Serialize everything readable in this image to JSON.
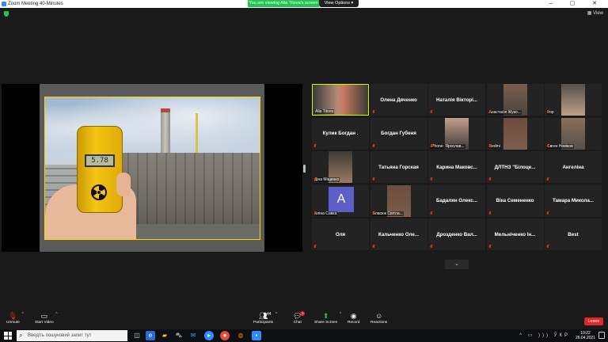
{
  "window": {
    "title": "Zoom Meeting 40-Minutes",
    "controls": "– ▢ ✕"
  },
  "banner": {
    "viewing_text": "You are viewing Alla Titova's screen",
    "view_options_label": "View Options ▾"
  },
  "topbar": {
    "view_label": "View"
  },
  "slide": {
    "dosimeter_reading": "5.78"
  },
  "gallery": {
    "tiles": [
      {
        "name": "Alla Titova",
        "style": "video"
      },
      {
        "name": "Олена Дяченко",
        "style": "name"
      },
      {
        "name": "Наталія Вікторі...",
        "style": "name"
      },
      {
        "name": "Анастасія Жуко...",
        "style": "video"
      },
      {
        "name": "Ігор",
        "style": "video"
      },
      {
        "name": "Кулик Богдан .",
        "style": "name"
      },
      {
        "name": "Богдан Губеня",
        "style": "name"
      },
      {
        "name": "iPhone: Ярослав...",
        "style": "video"
      },
      {
        "name": "Redmi",
        "style": "video"
      },
      {
        "name": "Євген Новіков",
        "style": "video"
      },
      {
        "name": "Діна Міщенко",
        "style": "video"
      },
      {
        "name": "Татьяна Горская",
        "style": "name"
      },
      {
        "name": "Карина Маковс...",
        "style": "name"
      },
      {
        "name": "ДЛТНЗ \"Білоце...",
        "style": "name"
      },
      {
        "name": "Ангеліна",
        "style": "name"
      },
      {
        "name": "Аліна Савка",
        "style": "avatar"
      },
      {
        "name": "Власюк Світла...",
        "style": "video"
      },
      {
        "name": "Бадалян Олекс...",
        "style": "name"
      },
      {
        "name": "Віка Семененко",
        "style": "name"
      },
      {
        "name": "Тамара Микола...",
        "style": "name"
      },
      {
        "name": "Оля",
        "style": "name"
      },
      {
        "name": "Кальченко Оле...",
        "style": "name"
      },
      {
        "name": "Дрозденко Вал...",
        "style": "name"
      },
      {
        "name": "Мельніченко Ін...",
        "style": "name"
      },
      {
        "name": "Best",
        "style": "name"
      }
    ],
    "avatar_letter": "A",
    "scroll_icon": "chevron-down-icon"
  },
  "toolbar": {
    "unmute_label": "Unmute",
    "start_video_label": "Start Video",
    "participants_label": "Participants",
    "participants_count": "44",
    "chat_label": "Chat",
    "chat_badge": "1",
    "share_screen_label": "Share Screen",
    "record_label": "Record",
    "reactions_label": "Reactions",
    "leave_label": "Leave"
  },
  "taskbar": {
    "search_placeholder": "Введіть пошуковий запит тут",
    "time": "10:22",
    "date": "26.04.2021"
  },
  "colors": {
    "accent_green": "#23c552",
    "active_speaker": "#c8ff00",
    "slide_border": "#ffd800",
    "leave_red": "#e02828"
  }
}
